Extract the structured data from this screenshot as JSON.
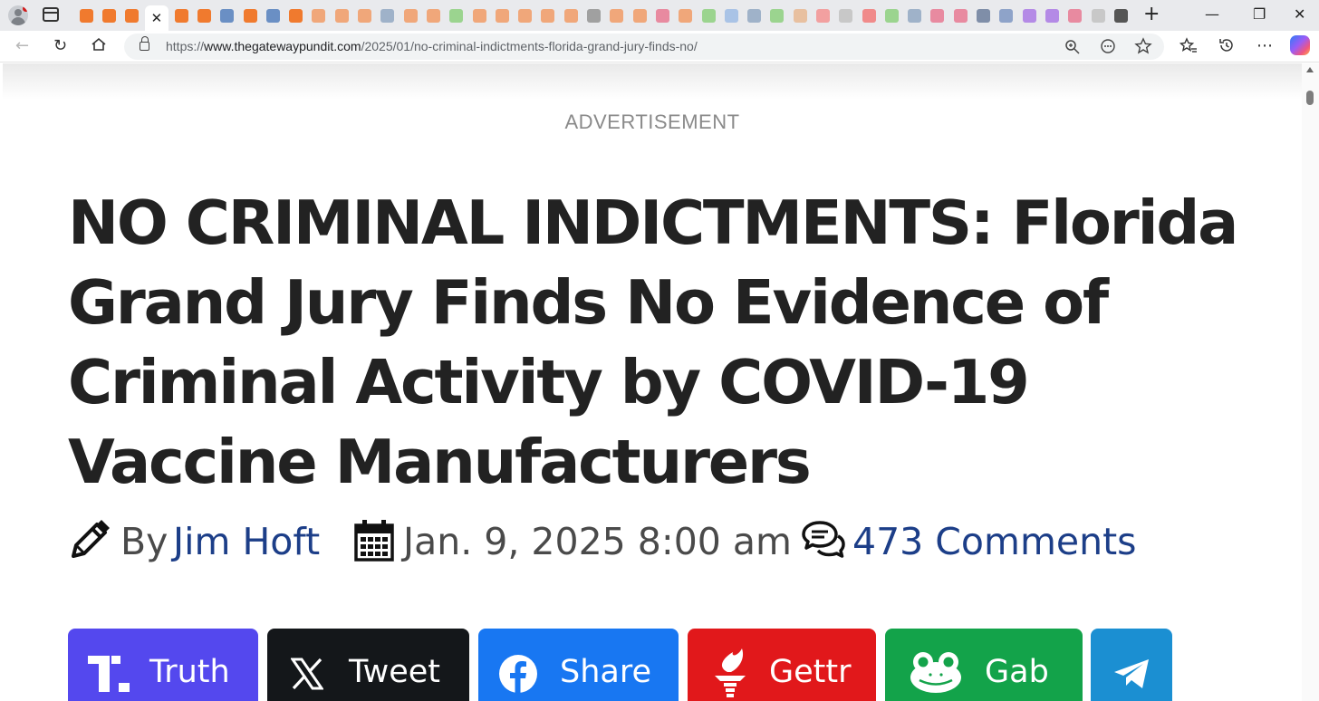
{
  "browser": {
    "tab_favicons": [
      {
        "color": "#f07a2e",
        "icon": "bookmark-icon"
      },
      {
        "color": "#f07a2e",
        "icon": "bookmark-icon"
      },
      {
        "color": "#f07a2e",
        "icon": "bookmark-icon"
      },
      {
        "color": "#ffffff",
        "icon": "close-icon",
        "active": true
      },
      {
        "color": "#f07a2e",
        "icon": "bookmark-icon"
      },
      {
        "color": "#f07a2e",
        "icon": "bookmark-icon"
      },
      {
        "color": "#6a8fc4",
        "icon": "globe-icon"
      },
      {
        "color": "#f07a2e",
        "icon": "bookmark-icon"
      },
      {
        "color": "#6a8fc4",
        "icon": "globe-icon"
      },
      {
        "color": "#f07a2e",
        "icon": "bookmark-icon"
      },
      {
        "color": "#f0a77a",
        "icon": "bookmark-icon"
      },
      {
        "color": "#f0a77a",
        "icon": "bookmark-icon"
      },
      {
        "color": "#f0a77a",
        "icon": "bookmark-icon"
      },
      {
        "color": "#9fb2c9",
        "icon": "globe-icon"
      },
      {
        "color": "#f0a77a",
        "icon": "bookmark-icon"
      },
      {
        "color": "#f0a77a",
        "icon": "bookmark-icon"
      },
      {
        "color": "#9bd48f",
        "icon": "play-icon"
      },
      {
        "color": "#f0a77a",
        "icon": "bookmark-icon"
      },
      {
        "color": "#f0a77a",
        "icon": "bookmark-icon"
      },
      {
        "color": "#f0a77a",
        "icon": "bookmark-icon"
      },
      {
        "color": "#f0a77a",
        "icon": "bookmark-icon"
      },
      {
        "color": "#f0a77a",
        "icon": "bookmark-icon"
      },
      {
        "color": "#a0a0a0",
        "icon": "news-icon"
      },
      {
        "color": "#f0a77a",
        "icon": "bookmark-icon"
      },
      {
        "color": "#f0a77a",
        "icon": "bookmark-icon"
      },
      {
        "color": "#e88aa0",
        "icon": "video-icon"
      },
      {
        "color": "#f0a77a",
        "icon": "bookmark-icon"
      },
      {
        "color": "#9bd48f",
        "icon": "play-icon"
      },
      {
        "color": "#a9c3e6",
        "icon": "search-icon"
      },
      {
        "color": "#9fb2c9",
        "icon": "globe-icon"
      },
      {
        "color": "#9bd48f",
        "icon": "play-icon"
      },
      {
        "color": "#e8c0a0",
        "icon": "blog-icon"
      },
      {
        "color": "#f2a0a0",
        "icon": "e-icon"
      },
      {
        "color": "#c8c8c8",
        "icon": "bird-icon"
      },
      {
        "color": "#f08a8a",
        "icon": "r-icon"
      },
      {
        "color": "#9bd48f",
        "icon": "play-icon"
      },
      {
        "color": "#9fb2c9",
        "icon": "globe-icon"
      },
      {
        "color": "#e88aa0",
        "icon": "video-icon"
      },
      {
        "color": "#e88aa0",
        "icon": "video-icon"
      },
      {
        "color": "#7f8ea8",
        "icon": "image-icon"
      },
      {
        "color": "#8ea3c9",
        "icon": "gp-icon"
      },
      {
        "color": "#b48ae6",
        "icon": "yahoo-icon"
      },
      {
        "color": "#b48ae6",
        "icon": "yahoo-icon"
      },
      {
        "color": "#e88aa0",
        "icon": "video-icon"
      },
      {
        "color": "#c8c8c8",
        "icon": "image-icon"
      },
      {
        "color": "#555555",
        "icon": "globe-icon"
      }
    ],
    "url_prefix": "https://",
    "url_domain": "www.thegatewaypundit.com",
    "url_path": "/2025/01/no-criminal-indictments-florida-grand-jury-finds-no/"
  },
  "page": {
    "ad_label": "ADVERTISEMENT",
    "headline": "NO CRIMINAL INDICTMENTS: Florida Grand Jury Finds No Evidence of Criminal Activity by COVID-19 Vaccine Manufacturers",
    "meta": {
      "by_label": "By",
      "author": "Jim Hoft",
      "date": "Jan. 9, 2025 8:00 am",
      "comments": "473 Comments"
    },
    "share_buttons": [
      {
        "label": "Truth",
        "color": "#5448ee"
      },
      {
        "label": "Tweet",
        "color": "#14171a"
      },
      {
        "label": "Share",
        "color": "#1877f2"
      },
      {
        "label": "Gettr",
        "color": "#e1181b"
      },
      {
        "label": "Gab",
        "color": "#13a34a"
      },
      {
        "label": "",
        "color": "#1b8fd2"
      }
    ]
  }
}
